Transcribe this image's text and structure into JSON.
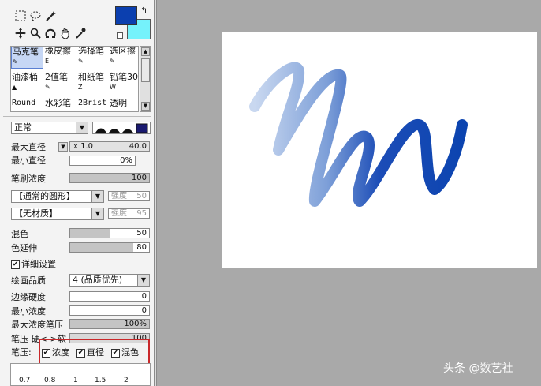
{
  "toolbar": {
    "tools": [
      "rect-select-icon",
      "lasso-icon",
      "magic-wand-icon",
      "move-icon",
      "zoom-icon",
      "rotate-icon",
      "hand-icon",
      "eyedropper-icon"
    ]
  },
  "colors": {
    "primary": "#0b3faf",
    "secondary": "#75f2fb",
    "swap": "↰"
  },
  "brushes": [
    {
      "label": "马克笔",
      "key": "",
      "selected": true
    },
    {
      "label": "橡皮擦",
      "key": "E",
      "selected": false
    },
    {
      "label": "选择笔",
      "key": "",
      "selected": false
    },
    {
      "label": "选区擦",
      "key": "",
      "selected": false
    },
    {
      "label": "油漆桶",
      "key": "",
      "selected": false
    },
    {
      "label": "2值笔",
      "key": "",
      "selected": false
    },
    {
      "label": "和纸笔",
      "key": "Z",
      "selected": false
    },
    {
      "label": "铅笔30",
      "key": "W",
      "selected": false
    },
    {
      "label": "Round",
      "key": "",
      "selected": false
    },
    {
      "label": "水彩笔",
      "key": "",
      "selected": false
    },
    {
      "label": "2Brist",
      "key": "",
      "selected": false
    },
    {
      "label": "透明",
      "key": "",
      "selected": false
    }
  ],
  "blend_mode": "正常",
  "settings": {
    "max_size_label": "最大直径",
    "max_size_mult": "x 1.0",
    "max_size_value": "40.0",
    "min_size_label": "最小直径",
    "min_size_value": "0%",
    "density_label": "笔刷浓度",
    "density_value": "100",
    "shape_combo": "【通常的圆形】",
    "shape_strength_label": "强度",
    "shape_strength_value": "50",
    "texture_combo": "【无材质】",
    "texture_strength_label": "强度",
    "texture_strength_value": "95",
    "blend_label": "混色",
    "blend_value": "50",
    "dilution_label": "色延伸",
    "dilution_value": "80",
    "advanced_label": "详细设置",
    "quality_label": "绘画品质",
    "quality_value": "4 (品质优先)",
    "edge_label": "边缘硬度",
    "edge_value": "0",
    "min_density_label": "最小浓度",
    "min_density_value": "0",
    "max_pressure_label": "最大浓度笔压",
    "max_pressure_value": "100%",
    "pressure_curve_label": "笔压 硬<->软",
    "pressure_curve_value": "100",
    "pressure_label": "笔压:",
    "pressure_density": "浓度",
    "pressure_size": "直径",
    "pressure_blend": "混色"
  },
  "size_presets": [
    "0.7",
    "0.8",
    "1",
    "1.5",
    "2"
  ],
  "watermark": "头条 @数艺社"
}
